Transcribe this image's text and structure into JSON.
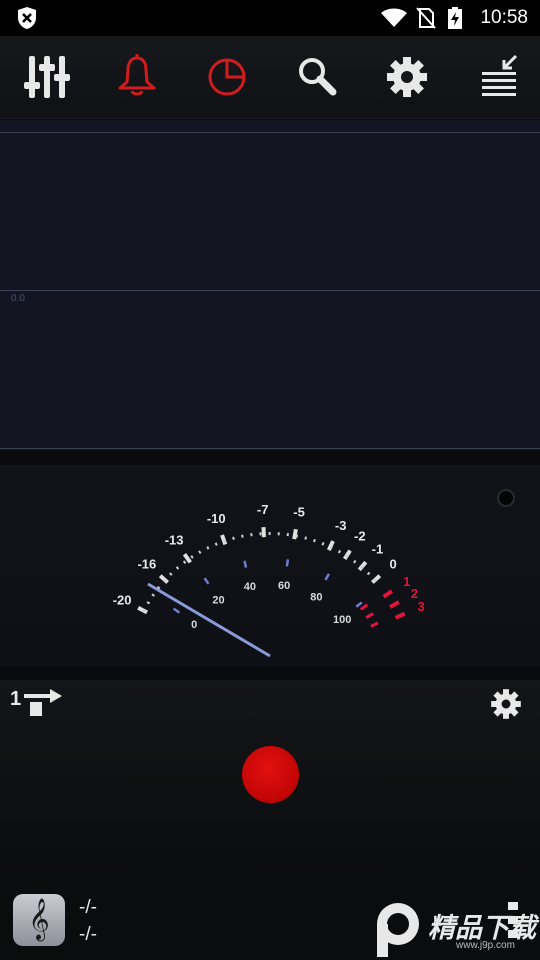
{
  "status_bar": {
    "time": "10:58",
    "icons": [
      "app-notification-icon",
      "wifi-icon",
      "no-sim-icon",
      "battery-charging-icon"
    ]
  },
  "toolbar": {
    "buttons": [
      "equalizer-icon",
      "bell-icon",
      "pie-chart-icon",
      "search-icon",
      "gear-icon",
      "list-collapse-icon"
    ],
    "accent_color": "#d11c1c"
  },
  "graph": {
    "zero_label": "0.0"
  },
  "vu_meter": {
    "db_labels": [
      "-20",
      "-16",
      "-13",
      "-10",
      "-7",
      "-5",
      "-3",
      "-2",
      "-1",
      "0",
      "1",
      "2",
      "3"
    ],
    "percent_labels": [
      "0",
      "20",
      "40",
      "60",
      "80",
      "100"
    ],
    "red_color": "#e0143c",
    "needle_value": "-20"
  },
  "controls": {
    "channel_label": "1",
    "record_color": "#d40a0a"
  },
  "bottom": {
    "note_primary": "-/-",
    "note_secondary": "-/-"
  },
  "watermark": {
    "brand": "精品下载",
    "url": "www.j9p.com"
  }
}
